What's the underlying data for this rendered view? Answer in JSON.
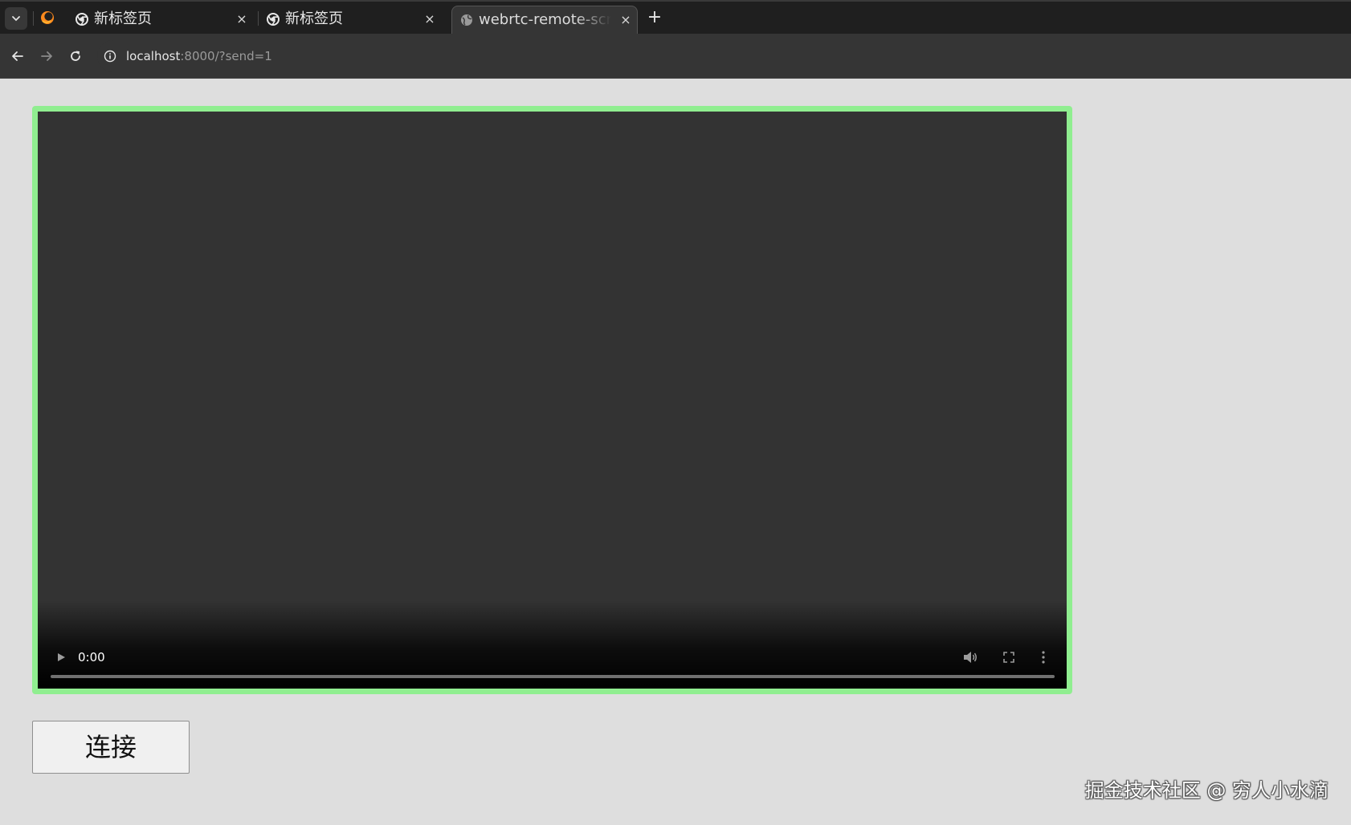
{
  "browser": {
    "tabs": [
      {
        "title": "新标签页",
        "active": false
      },
      {
        "title": "新标签页",
        "active": false
      },
      {
        "title": "webrtc-remote-screen",
        "active": true
      }
    ],
    "new_tab_label": "+",
    "close_glyph": "×",
    "url": {
      "host": "localhost",
      "rest": ":8000/?send=1"
    }
  },
  "video": {
    "time": "0:00",
    "border_color": "#90ee90",
    "background_color": "#333333"
  },
  "connect_button": {
    "label": "连接"
  },
  "watermark": "掘金技术社区 @ 穷人小水滴",
  "icons": [
    "chevron-down-icon",
    "firefox-icon",
    "chrome-icon",
    "globe-icon",
    "close-icon",
    "plus-icon",
    "back-arrow-icon",
    "forward-arrow-icon",
    "reload-icon",
    "info-icon",
    "play-icon",
    "volume-icon",
    "fullscreen-icon",
    "more-vertical-icon"
  ]
}
